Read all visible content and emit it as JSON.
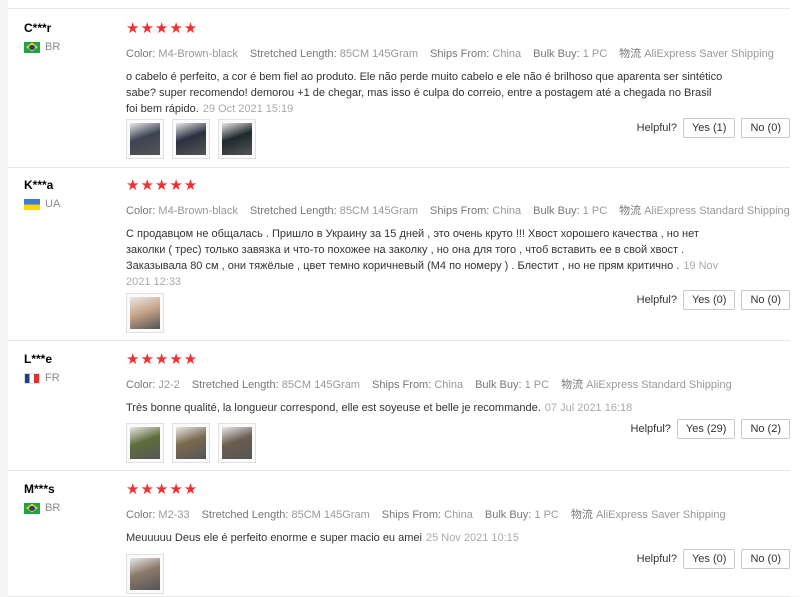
{
  "reviews": [
    {
      "user": "C***r",
      "country": "BR",
      "stars": "★★★★★",
      "color": "M4-Brown-black",
      "stretched": "85CM 145Gram",
      "ships": "China",
      "bulk": "1 PC",
      "shipping": "AliExpress Saver Shipping",
      "text": "o cabelo é perfeito, a cor é bem fiel ao produto. Ele não perde muito cabelo e ele não é brilhoso que aparenta ser sintético sabe? super recomendo! demorou +1 de chegar, mas isso é culpa do correio, entre a postagem até a chegada no Brasil foi bem rápido.",
      "date": "29 Oct 2021 15:19",
      "photo_count": 3,
      "yes": "Yes (1)",
      "no": "No (0)"
    },
    {
      "user": "K***a",
      "country": "UA",
      "stars": "★★★★★",
      "color": "M4-Brown-black",
      "stretched": "85CM 145Gram",
      "ships": "China",
      "bulk": "1 PC",
      "shipping": "AliExpress Standard Shipping",
      "text": "С продавцом не общалась . Пришло в Украину за 15 дней , это очень круто !!! Хвост хорошего качества , но нет заколки ( трес) только завязка и что-то похожее на заколку , но она для того , чтоб вставить ее в свой хвост . Заказывала 80 см , они тяжёлые , цвет темно коричневый (М4 по номеру ) . Блестит , но не прям критично .",
      "date": "19 Nov 2021 12:33",
      "photo_count": 1,
      "yes": "Yes (0)",
      "no": "No (0)"
    },
    {
      "user": "L***e",
      "country": "FR",
      "stars": "★★★★★",
      "color": "J2-2",
      "stretched": "85CM 145Gram",
      "ships": "China",
      "bulk": "1 PC",
      "shipping": "AliExpress Standard Shipping",
      "text": "Très bonne qualité, la longueur correspond, elle est soyeuse et belle je recommande.",
      "date": "07 Jul 2021 16:18",
      "photo_count": 3,
      "yes": "Yes (29)",
      "no": "No (2)"
    },
    {
      "user": "M***s",
      "country": "BR",
      "stars": "★★★★★",
      "color": "M2-33",
      "stretched": "85CM 145Gram",
      "ships": "China",
      "bulk": "1 PC",
      "shipping": "AliExpress Saver Shipping",
      "text": "Meuuuuu Deus ele é perfeito enorme e super macio eu amei",
      "date": "25 Nov 2021 10:15",
      "photo_count": 1,
      "yes": "Yes (0)",
      "no": "No (0)"
    }
  ],
  "labels": {
    "color": "Color:",
    "stretched": "Stretched Length:",
    "ships": "Ships From:",
    "bulk": "Bulk Buy:",
    "logistics": "物流",
    "helpful": "Helpful?"
  },
  "colors": {
    "star": "#f52f2f",
    "border": "#e8e8e8"
  }
}
